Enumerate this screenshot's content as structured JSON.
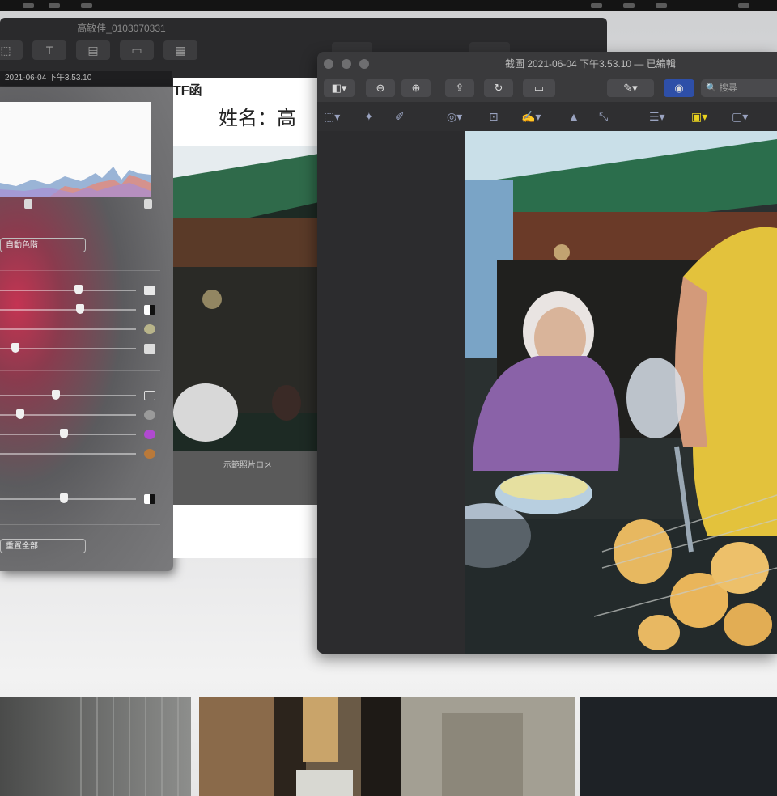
{
  "menubar": {},
  "back_window": {
    "title": "高敏佳_0103070331",
    "toolbar": [
      "⬚",
      "T",
      "▤",
      "▭",
      "▦"
    ],
    "subtitle": "2021-06-04 下午3.53.10"
  },
  "adjust_panel": {
    "auto_levels_label": "自動色階",
    "reset_label": "重置全部"
  },
  "document": {
    "header_fragment": "TF函",
    "name_label": "姓名：高",
    "caption": "示範照片ロメ"
  },
  "preview": {
    "title": "截圖 2021-06-04 下午3.53.10 — 已編輯",
    "search_placeholder": "搜尋"
  },
  "colors": {
    "menubar": "#141414",
    "window_dark": "#2b2b2d",
    "accent_blue": "#4b6fe0",
    "accent_yellow": "#e9d21f"
  }
}
